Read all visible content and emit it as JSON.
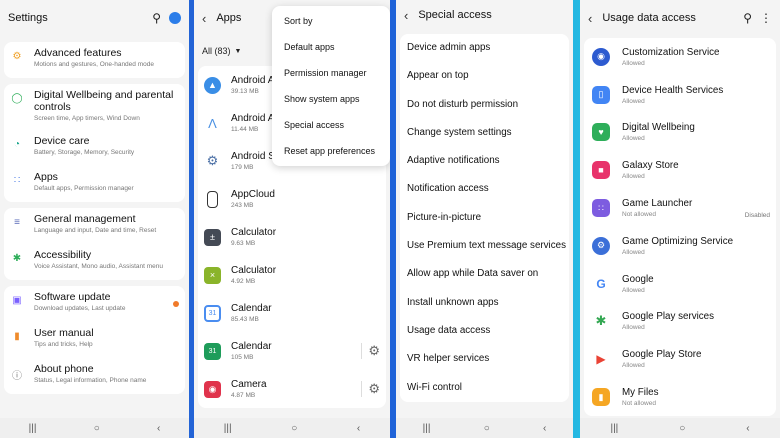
{
  "settings": {
    "title": "Settings",
    "items": [
      {
        "label": "Advanced features",
        "sub": "Motions and gestures, One-handed mode",
        "icon": "gear-plus-icon",
        "color": "#f0a22a"
      },
      {
        "label": "Digital Wellbeing and parental controls",
        "sub": "Screen time, App timers, Wind Down",
        "icon": "wellbeing-icon",
        "color": "#2eae5a"
      },
      {
        "label": "Device care",
        "sub": "Battery, Storage, Memory, Security",
        "icon": "device-care-icon",
        "color": "#1aa58c"
      },
      {
        "label": "Apps",
        "sub": "Default apps, Permission manager",
        "icon": "apps-grid-icon",
        "color": "#4d7ce6"
      },
      {
        "label": "General management",
        "sub": "Language and input, Date and time, Reset",
        "icon": "sliders-icon",
        "color": "#5a6bb8"
      },
      {
        "label": "Accessibility",
        "sub": "Voice Assistant, Mono audio, Assistant menu",
        "icon": "accessibility-icon",
        "color": "#2eae5a"
      },
      {
        "label": "Software update",
        "sub": "Download updates, Last update",
        "icon": "software-update-icon",
        "color": "#7b61ff"
      },
      {
        "label": "User manual",
        "sub": "Tips and tricks, Help",
        "icon": "manual-icon",
        "color": "#ef8b2c"
      },
      {
        "label": "About phone",
        "sub": "Status, Legal information, Phone name",
        "icon": "info-icon",
        "color": "#777777"
      }
    ]
  },
  "apps": {
    "title": "Apps",
    "filter": "All (83)",
    "menu": [
      "Sort by",
      "Default apps",
      "Permission manager",
      "Show system apps",
      "Special access",
      "Reset app preferences"
    ],
    "list": [
      {
        "name": "Android A",
        "size": "39.13 MB",
        "icon": "android-auto-icon",
        "color": "#3a8ee6"
      },
      {
        "name": "Android A",
        "size": "11.44 MB",
        "icon": "android-accessibility-icon",
        "color": "#4a90e2"
      },
      {
        "name": "Android System WebView",
        "size": "179 MB",
        "icon": "webview-gear-icon",
        "color": "#4a6fa5"
      },
      {
        "name": "AppCloud",
        "size": "243 MB",
        "icon": "appcloud-icon",
        "color": "#ffffff"
      },
      {
        "name": "Calculator",
        "size": "9.63 MB",
        "icon": "calculator-icon",
        "color": "#444a55"
      },
      {
        "name": "Calculator",
        "size": "4.92 MB",
        "icon": "calculator-green-icon",
        "color": "#8ab42a"
      },
      {
        "name": "Calendar",
        "size": "85.43 MB",
        "icon": "calendar-google-icon",
        "color": "#4a8df0"
      },
      {
        "name": "Calendar",
        "size": "105 MB",
        "icon": "calendar-samsung-icon",
        "color": "#1e9c5a"
      },
      {
        "name": "Camera",
        "size": "4.87 MB",
        "icon": "camera-icon",
        "color": "#e0334c"
      }
    ]
  },
  "special": {
    "title": "Special access",
    "items": [
      "Device admin apps",
      "Appear on top",
      "Do not disturb permission",
      "Change system settings",
      "Adaptive notifications",
      "Notification access",
      "Picture-in-picture",
      "Use Premium text message services",
      "Allow app while Data saver on",
      "Install unknown apps",
      "Usage data access",
      "VR helper services",
      "Wi-Fi control"
    ]
  },
  "usage": {
    "title": "Usage data access",
    "items": [
      {
        "name": "Customization Service",
        "status": "Allowed",
        "icon": "customization-icon",
        "color": "#2d5bd0",
        "side": ""
      },
      {
        "name": "Device Health Services",
        "status": "Allowed",
        "icon": "device-health-icon",
        "color": "#4285f4",
        "side": ""
      },
      {
        "name": "Digital Wellbeing",
        "status": "Allowed",
        "icon": "digital-wellbeing-icon",
        "color": "#2eae5a",
        "side": ""
      },
      {
        "name": "Galaxy Store",
        "status": "Allowed",
        "icon": "galaxy-store-icon",
        "color": "#e8336b",
        "side": ""
      },
      {
        "name": "Game Launcher",
        "status": "Not allowed",
        "icon": "game-launcher-icon",
        "color": "#7d5ce0",
        "side": "Disabled"
      },
      {
        "name": "Game Optimizing Service",
        "status": "Allowed",
        "icon": "game-optimizing-icon",
        "color": "#3b6fd8",
        "side": ""
      },
      {
        "name": "Google",
        "status": "Allowed",
        "icon": "google-icon",
        "color": "#ffffff",
        "side": ""
      },
      {
        "name": "Google Play services",
        "status": "Allowed",
        "icon": "play-services-icon",
        "color": "#ffffff",
        "side": ""
      },
      {
        "name": "Google Play Store",
        "status": "Allowed",
        "icon": "play-store-icon",
        "color": "#ffffff",
        "side": ""
      },
      {
        "name": "My Files",
        "status": "Not allowed",
        "icon": "my-files-icon",
        "color": "#f5a623",
        "side": ""
      }
    ]
  },
  "nav": {
    "recents": "|||",
    "home": "○",
    "back": "‹"
  }
}
